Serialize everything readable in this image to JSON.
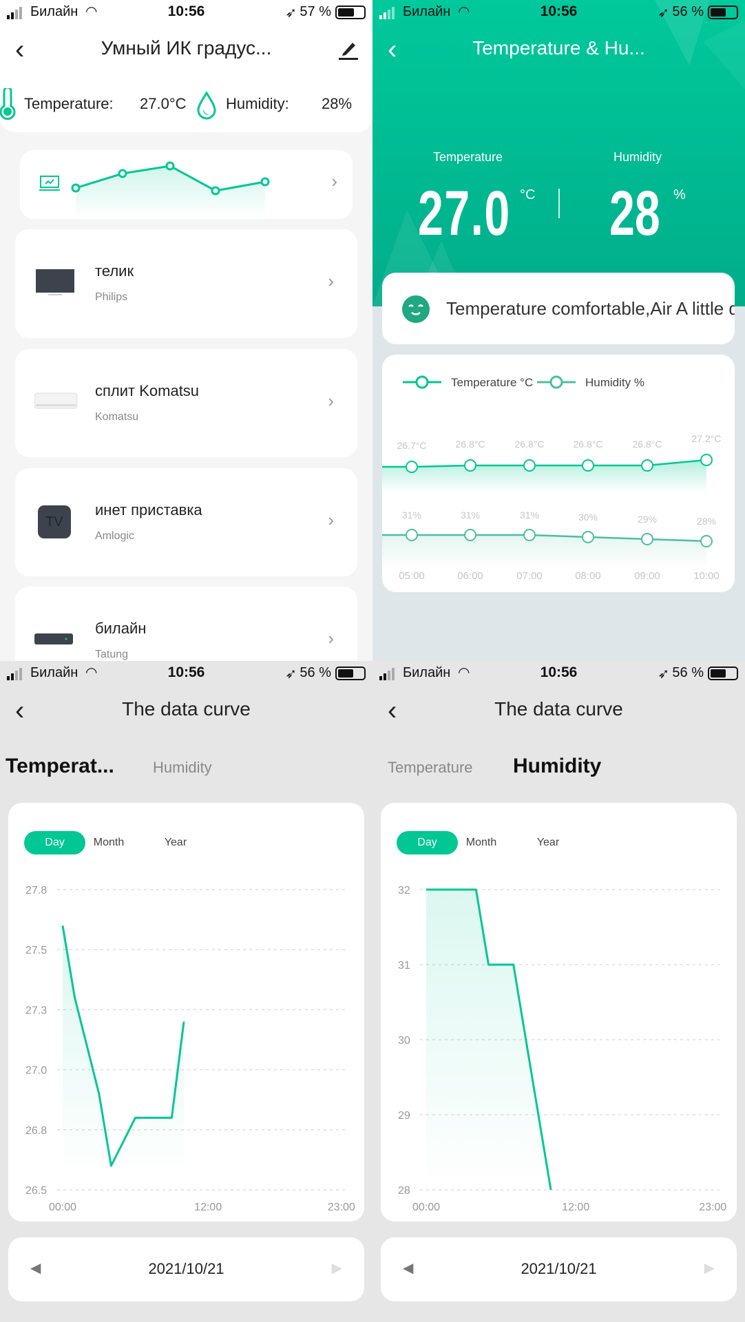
{
  "colors": {
    "accent": "#00c793",
    "humidity_line": "#4cbf9f",
    "header_green": "#00b48e"
  },
  "screens": [
    {
      "status": {
        "carrier": "Билайн",
        "time": "10:56",
        "battery": "57 %",
        "battery_level": 57
      },
      "title": "Умный ИК градус...",
      "readings": {
        "temp_label": "Temperature:",
        "temp_value": "27.0°C",
        "hum_label": "Humidity:",
        "hum_value": "28%"
      },
      "devices": [
        {
          "name": "телик",
          "brand": "Philips",
          "icon": "tv-icon"
        },
        {
          "name": "сплит Komatsu",
          "brand": "Komatsu",
          "icon": "air-conditioner-icon"
        },
        {
          "name": "инет приставка",
          "brand": "Amlogic",
          "icon": "tv-box-icon",
          "icon_text": "TV"
        },
        {
          "name": "билайн",
          "brand": "Tatung",
          "icon": "set-top-box-icon"
        }
      ]
    },
    {
      "status": {
        "carrier": "Билайн",
        "time": "10:56",
        "battery": "56 %",
        "battery_level": 56
      },
      "title": "Temperature & Hu...",
      "temp_label": "Temperature",
      "temp_value": "27.0",
      "temp_unit": "°C",
      "hum_label": "Humidity",
      "hum_value": "28",
      "hum_unit": "%",
      "comfort": "Temperature comfortable,Air A little d"
    },
    {
      "status": {
        "carrier": "Билайн",
        "time": "10:56",
        "battery": "56 %",
        "battery_level": 56
      },
      "title": "The data curve",
      "tabs": [
        "Temperat...",
        "Humidity"
      ],
      "active_tab": 0,
      "ranges": [
        "Day",
        "Month",
        "Year"
      ],
      "active_range": "Day",
      "date": "2021/10/21"
    },
    {
      "status": {
        "carrier": "Билайн",
        "time": "10:56",
        "battery": "56 %",
        "battery_level": 56
      },
      "title": "The data curve",
      "tabs": [
        "Temperature",
        "Humidity"
      ],
      "active_tab": 1,
      "ranges": [
        "Day",
        "Month",
        "Year"
      ],
      "active_range": "Day",
      "date": "2021/10/21"
    }
  ],
  "chart_data": [
    {
      "type": "line",
      "legend_placement": "top",
      "series": [
        {
          "name": "Temperature °C",
          "x": [
            "05:00",
            "06:00",
            "07:00",
            "08:00",
            "09:00",
            "10:00"
          ],
          "values": [
            26.7,
            26.8,
            26.8,
            26.8,
            26.8,
            27.2
          ],
          "labels": [
            "26.7°C",
            "26.8°C",
            "26.8°C",
            "26.8°C",
            "26.8°C",
            "27.2°C"
          ]
        },
        {
          "name": "Humidity %",
          "x": [
            "05:00",
            "06:00",
            "07:00",
            "08:00",
            "09:00",
            "10:00"
          ],
          "values": [
            31,
            31,
            31,
            30,
            29,
            28
          ],
          "labels": [
            "31%",
            "31%",
            "31%",
            "30%",
            "29%",
            "28%"
          ]
        }
      ]
    },
    {
      "type": "area",
      "xlabel": "",
      "ylabel": "",
      "x_ticks": [
        "00:00",
        "12:00",
        "23:00"
      ],
      "y_ticks": [
        "27.8",
        "27.5",
        "27.3",
        "27.0",
        "26.8",
        "26.5"
      ],
      "ylim": [
        26.5,
        27.75
      ],
      "xlim": [
        0,
        23
      ],
      "grid": true,
      "x": [
        0,
        1,
        2,
        3,
        4,
        5,
        6,
        7,
        8,
        9,
        10
      ],
      "values": [
        27.6,
        27.3,
        27.1,
        26.9,
        26.6,
        26.7,
        26.8,
        26.8,
        26.8,
        26.8,
        27.2
      ]
    },
    {
      "type": "area",
      "xlabel": "",
      "ylabel": "",
      "x_ticks": [
        "00:00",
        "12:00",
        "23:00"
      ],
      "y_ticks": [
        "32",
        "31",
        "30",
        "29",
        "28"
      ],
      "ylim": [
        28,
        32
      ],
      "xlim": [
        0,
        23
      ],
      "grid": true,
      "x": [
        0,
        1,
        2,
        3,
        4,
        5,
        6,
        7,
        8,
        9,
        10
      ],
      "values": [
        32,
        32,
        32,
        32,
        32,
        31,
        31,
        31,
        30,
        29,
        28
      ]
    }
  ]
}
